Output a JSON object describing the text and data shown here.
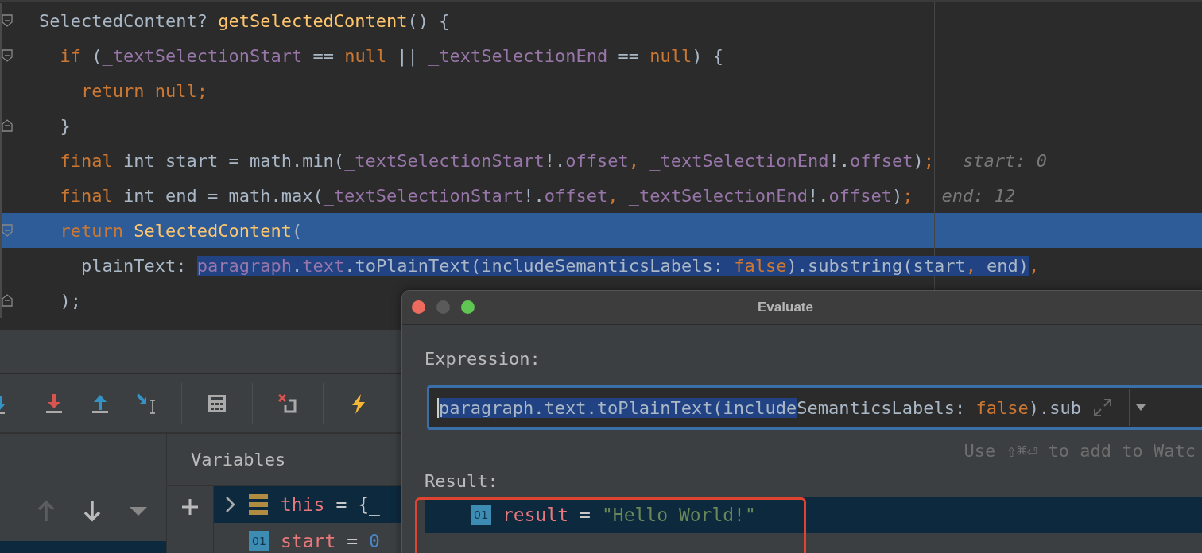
{
  "editor": {
    "lines": [
      {
        "fold_start": true,
        "current": false,
        "tokens": [
          {
            "kind": "plain",
            "text": "SelectedContent? "
          },
          {
            "kind": "function",
            "text": "getSelectedContent"
          },
          {
            "kind": "plain",
            "text": "() {"
          }
        ]
      },
      {
        "fold_start": true,
        "current": false,
        "tokens": [
          {
            "kind": "keyword",
            "text": "  if"
          },
          {
            "kind": "plain",
            "text": " ("
          },
          {
            "kind": "field",
            "text": "_textSelectionStart"
          },
          {
            "kind": "plain",
            "text": " == "
          },
          {
            "kind": "keyword",
            "text": "null"
          },
          {
            "kind": "plain",
            "text": " || "
          },
          {
            "kind": "field",
            "text": "_textSelectionEnd"
          },
          {
            "kind": "plain",
            "text": " == "
          },
          {
            "kind": "keyword",
            "text": "null"
          },
          {
            "kind": "plain",
            "text": ") {"
          }
        ]
      },
      {
        "current": false,
        "tokens": [
          {
            "kind": "keyword",
            "text": "    return null;"
          }
        ]
      },
      {
        "fold_end": true,
        "current": false,
        "tokens": [
          {
            "kind": "plain",
            "text": "  }"
          }
        ]
      },
      {
        "current": false,
        "hint": "start: 0",
        "tokens": [
          {
            "kind": "keyword",
            "text": "  final"
          },
          {
            "kind": "plain",
            "text": " int start = math.min("
          },
          {
            "kind": "field",
            "text": "_textSelectionStart"
          },
          {
            "kind": "plain",
            "text": "!."
          },
          {
            "kind": "field",
            "text": "offset"
          },
          {
            "kind": "keyword",
            "text": ", "
          },
          {
            "kind": "field",
            "text": "_textSelectionEnd"
          },
          {
            "kind": "plain",
            "text": "!."
          },
          {
            "kind": "field",
            "text": "offset"
          },
          {
            "kind": "plain",
            "text": ")"
          },
          {
            "kind": "keyword",
            "text": ";"
          }
        ]
      },
      {
        "current": false,
        "hint": "end: 12",
        "tokens": [
          {
            "kind": "keyword",
            "text": "  final"
          },
          {
            "kind": "plain",
            "text": " int end = math.max("
          },
          {
            "kind": "field",
            "text": "_textSelectionStart"
          },
          {
            "kind": "plain",
            "text": "!."
          },
          {
            "kind": "field",
            "text": "offset"
          },
          {
            "kind": "keyword",
            "text": ", "
          },
          {
            "kind": "field",
            "text": "_textSelectionEnd"
          },
          {
            "kind": "plain",
            "text": "!."
          },
          {
            "kind": "field",
            "text": "offset"
          },
          {
            "kind": "plain",
            "text": ")"
          },
          {
            "kind": "keyword",
            "text": ";"
          }
        ]
      },
      {
        "fold_start": true,
        "current": true,
        "tokens": [
          {
            "kind": "keyword",
            "text": "  return "
          },
          {
            "kind": "function",
            "text": "SelectedContent"
          },
          {
            "kind": "plain",
            "text": "("
          }
        ]
      },
      {
        "current": false,
        "tokens": [
          {
            "kind": "plain",
            "text": "    plainText: ",
            "selected": false
          },
          {
            "kind": "field",
            "text": "paragraph",
            "selected": true
          },
          {
            "kind": "plain",
            "text": ".",
            "selected": true
          },
          {
            "kind": "field",
            "text": "text",
            "selected": true
          },
          {
            "kind": "plain",
            "text": ".toPlainText(includeSemanticsLabels: ",
            "selected": true
          },
          {
            "kind": "keyword",
            "text": "false",
            "selected": true
          },
          {
            "kind": "plain",
            "text": ").substring(start",
            "selected": true
          },
          {
            "kind": "keyword",
            "text": ",",
            "selected": true
          },
          {
            "kind": "plain",
            "text": " end)",
            "selected": true
          },
          {
            "kind": "keyword",
            "text": ",",
            "selected": false
          }
        ]
      },
      {
        "fold_end": true,
        "current": false,
        "tokens": [
          {
            "kind": "plain",
            "text": "  );"
          }
        ]
      }
    ]
  },
  "debugger": {
    "frames": [
      {
        "selected": true
      }
    ],
    "variables": {
      "title": "Variables",
      "rows": [
        {
          "kind": "object",
          "name": "this",
          "operator": "=",
          "value": "{_",
          "selected": true,
          "expanded": false
        },
        {
          "kind": "primitive",
          "badge": "01",
          "name": "start",
          "operator": "=",
          "value": "0",
          "selected": false
        }
      ]
    }
  },
  "dialog": {
    "title": "Evaluate",
    "expression_label": "Expression:",
    "expression": [
      {
        "kind": "plain",
        "text": "paragraph.text.toPlainText(include",
        "selected": true
      },
      {
        "kind": "plain",
        "text": "SemanticsLabels: ",
        "selected": false
      },
      {
        "kind": "keyword",
        "text": "false",
        "selected": false
      },
      {
        "kind": "plain",
        "text": ").sub",
        "selected": false
      }
    ],
    "hint": "Use ⇧⌘⏎ to add to Watc",
    "result_label": "Result:",
    "result": {
      "kind": "primitive",
      "badge": "01",
      "name": "result",
      "operator": "=",
      "value": "\"Hello World!\"",
      "selected": true
    }
  }
}
